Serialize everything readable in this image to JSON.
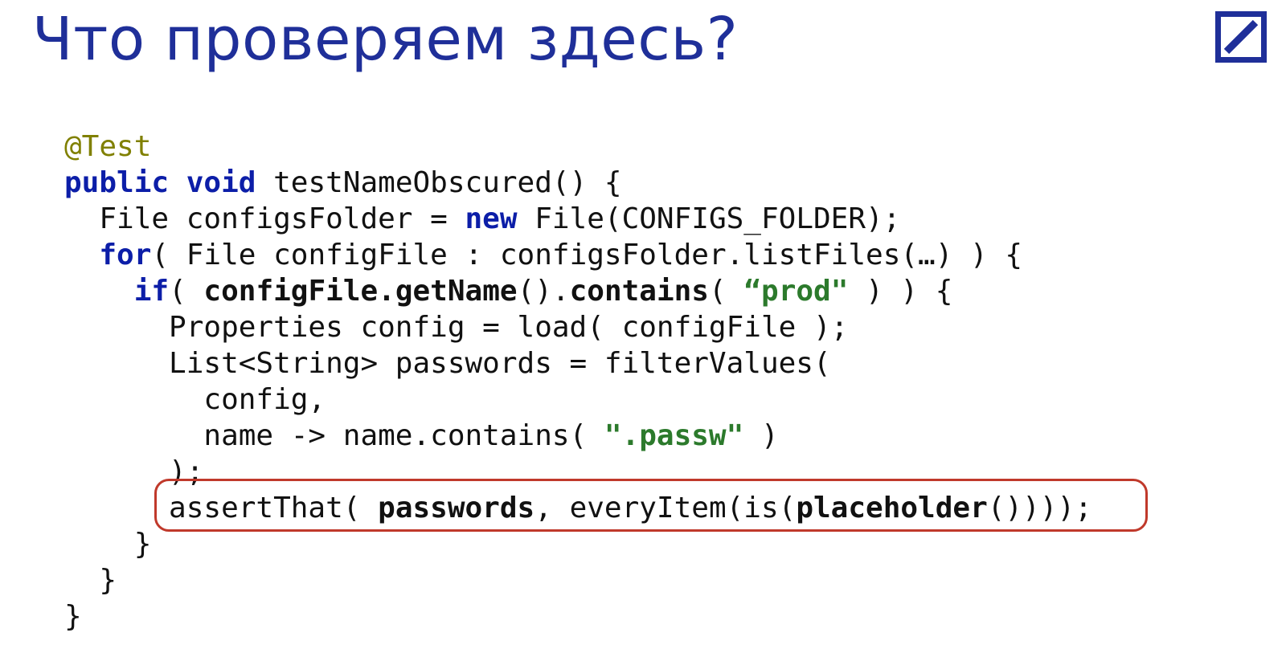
{
  "title": "Что проверяем здесь?",
  "code": {
    "annotation": "@Test",
    "kw_public": "public",
    "kw_void": "void",
    "method_sig": " testNameObscured() {",
    "l3a": "  File configsFolder = ",
    "kw_new": "new",
    "l3b": " File(CONFIGS_FOLDER);",
    "l4a": "  ",
    "kw_for": "for",
    "l4b": "( File configFile : configsFolder.listFiles(…) ) {",
    "l5a": "    ",
    "kw_if": "if",
    "l5b": "( ",
    "l5c": "configFile.getName",
    "l5d": "().",
    "l5e": "contains",
    "l5f": "( ",
    "l5str": "“prod\"",
    "l5g": " ) ) {",
    "l6": "      Properties config = load( configFile );",
    "l7": "      List<String> passwords = filterValues(",
    "l8": "        config,",
    "l9a": "        name -> name.contains( ",
    "l9str": "\".passw\"",
    "l9b": " )",
    "l10": "      );",
    "l11a": "      assertThat( ",
    "l11b": "passwords",
    "l11c": ", everyItem(is(",
    "l11d": "placeholder",
    "l11e": "())));",
    "l12": "    }",
    "l13": "  }",
    "l14": "}"
  }
}
